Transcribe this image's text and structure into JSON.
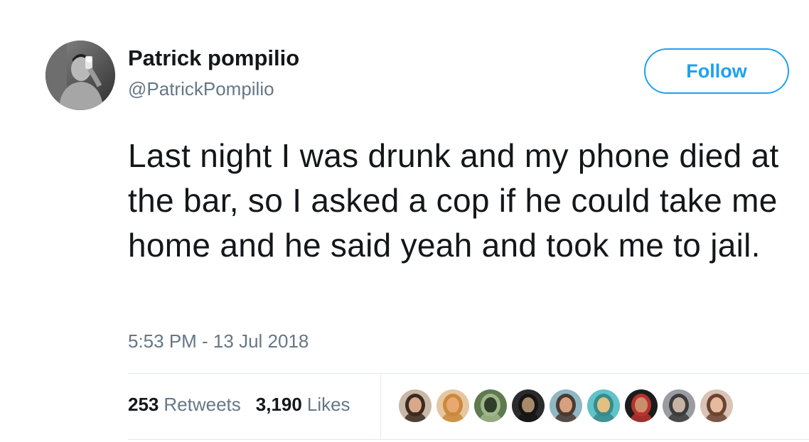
{
  "author": {
    "display_name": "Patrick pompilio",
    "handle": "@PatrickPompilio",
    "avatar_icon": "profile-photo"
  },
  "follow_button": {
    "label": "Follow",
    "color": "#1da1f2"
  },
  "tweet": {
    "text": "Last night I was drunk and my phone died at the bar, so I asked a cop if he could take me home and he said yeah and took me to jail.",
    "timestamp": "5:53 PM - 13 Jul 2018"
  },
  "stats": {
    "retweets": {
      "count": "253",
      "label": "Retweets"
    },
    "likes": {
      "count": "3,190",
      "label": "Likes"
    }
  },
  "likers": [
    {
      "bg": "#c9b8a6",
      "skin": "#d9a88a",
      "hair": "#3b2a20"
    },
    {
      "bg": "#e6c5a0",
      "skin": "#e8a870",
      "hair": "#c98a3a"
    },
    {
      "bg": "#5e7a4e",
      "skin": "#2f3d2a",
      "hair": "#9fb58a"
    },
    {
      "bg": "#2b2b2b",
      "skin": "#a8896a",
      "hair": "#151515"
    },
    {
      "bg": "#8fb7c4",
      "skin": "#d7a07e",
      "hair": "#4a3a30"
    },
    {
      "bg": "#5fc3c8",
      "skin": "#e2c080",
      "hair": "#3a8a8c"
    },
    {
      "bg": "#1c1c1c",
      "skin": "#c98f6a",
      "hair": "#b8322e"
    },
    {
      "bg": "#9a9ca2",
      "skin": "#c7b2a4",
      "hair": "#3c3c3c"
    },
    {
      "bg": "#d9c3b6",
      "skin": "#e7b9a0",
      "hair": "#6b4431"
    }
  ],
  "colors": {
    "text_primary": "#14171a",
    "text_secondary": "#657786",
    "divider": "#e1e8ed",
    "accent": "#1da1f2"
  }
}
